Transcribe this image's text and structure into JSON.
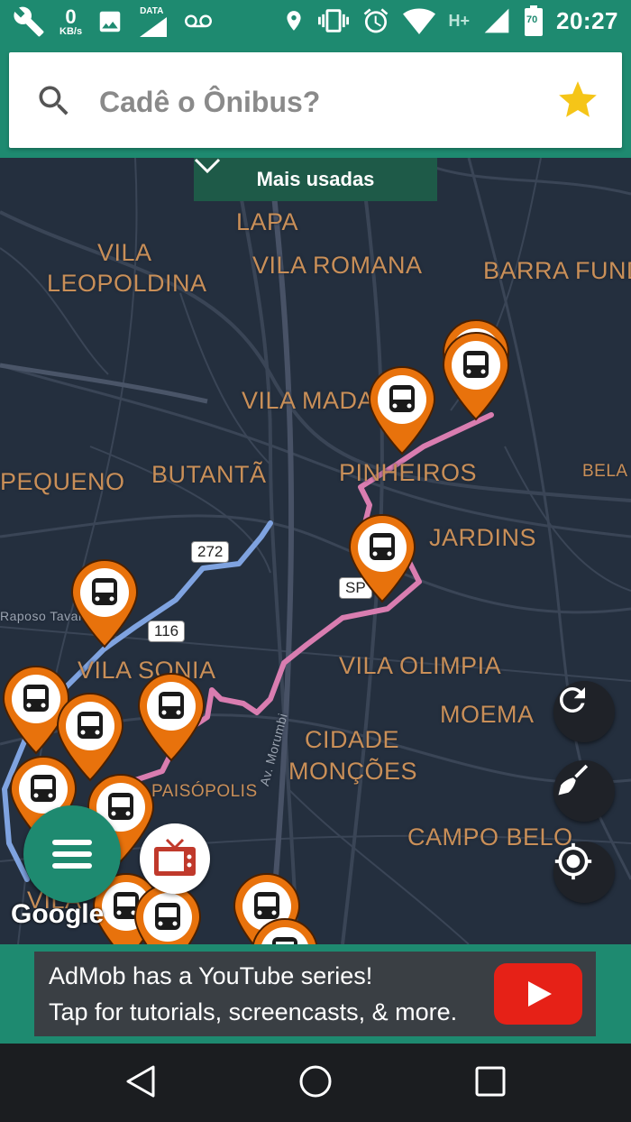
{
  "status_bar": {
    "net_speed_value": "0",
    "net_speed_unit": "KB/s",
    "data_label": "DATA",
    "network_type": "H+",
    "battery_level": "70",
    "time": "20:27"
  },
  "search": {
    "placeholder": "Cadê o Ônibus?"
  },
  "map": {
    "filter_label": "Mais usadas",
    "places": [
      "LAPA",
      "VILA",
      "LEOPOLDINA",
      "VILA ROMANA",
      "BARRA FUND",
      "VILA MADA",
      "PEQUENO",
      "BUTANTÃ",
      "PINHEIROS",
      "BELA",
      "JARDINS",
      "Raposo Tavar",
      "VILA SONIA",
      "VILA OLIMPIA",
      "MOEMA",
      "CIDADE",
      "MONÇÕES",
      "PAISÓPOLIS",
      "Av. Morumbi",
      "CAMPO BELO",
      "VILA"
    ],
    "roads": [
      "272",
      "116",
      "SP"
    ],
    "attribution": "Google"
  },
  "ad": {
    "line1": "AdMob has a YouTube series!",
    "line2": "Tap for tutorials, screencasts, & more."
  },
  "colors": {
    "primary": "#1e8a70",
    "map_background": "#242f3e",
    "map_label": "#c98f58",
    "bus_pin": "#e8720c",
    "route_blue": "#7fa3e0",
    "route_pink": "#d97db0",
    "star": "#f5c518"
  },
  "icons": [
    "wrench-icon",
    "image-icon",
    "voicemail-icon",
    "location-icon",
    "vibrate-icon",
    "alarm-icon",
    "wifi-icon",
    "signal-icon",
    "battery-icon",
    "search-icon",
    "star-icon",
    "chevron-down-icon",
    "bus-icon",
    "refresh-icon",
    "broom-icon",
    "my-location-icon",
    "menu-icon",
    "tv-icon",
    "play-icon",
    "back-icon",
    "home-icon",
    "recents-icon"
  ]
}
